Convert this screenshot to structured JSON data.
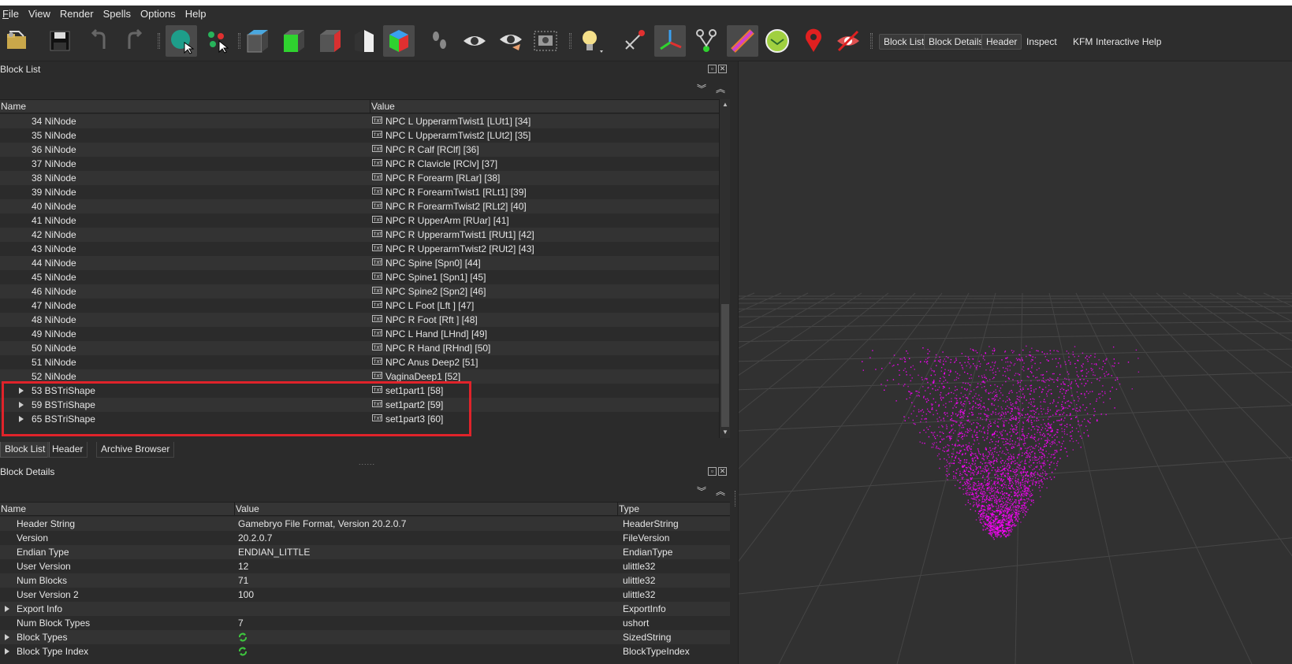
{
  "window": {
    "title_fragment": ""
  },
  "menubar": [
    {
      "label": "File",
      "mnemonic": "F",
      "rest": "ile"
    },
    {
      "label": "View"
    },
    {
      "label": "Render"
    },
    {
      "label": "Spells"
    },
    {
      "label": "Options"
    },
    {
      "label": "Help"
    }
  ],
  "toolbar": {
    "text_buttons": {
      "block_list": "Block List",
      "block_details": "Block Details",
      "header": "Header",
      "inspect": "Inspect",
      "kfm": "KFM",
      "interactive_help": "Interactive Help"
    }
  },
  "block_list": {
    "title": "Block List",
    "columns": {
      "name": "Name",
      "value": "Value"
    },
    "rows": [
      {
        "name": "34 NiNode",
        "value": "NPC L UpperarmTwist1 [LUt1] [34]"
      },
      {
        "name": "35 NiNode",
        "value": "NPC L UpperarmTwist2 [LUt2] [35]"
      },
      {
        "name": "36 NiNode",
        "value": "NPC R Calf [RClf] [36]"
      },
      {
        "name": "37 NiNode",
        "value": "NPC R Clavicle [RClv] [37]"
      },
      {
        "name": "38 NiNode",
        "value": "NPC R Forearm [RLar] [38]"
      },
      {
        "name": "39 NiNode",
        "value": "NPC R ForearmTwist1 [RLt1] [39]"
      },
      {
        "name": "40 NiNode",
        "value": "NPC R ForearmTwist2 [RLt2] [40]"
      },
      {
        "name": "41 NiNode",
        "value": "NPC R UpperArm [RUar] [41]"
      },
      {
        "name": "42 NiNode",
        "value": "NPC R UpperarmTwist1 [RUt1] [42]"
      },
      {
        "name": "43 NiNode",
        "value": "NPC R UpperarmTwist2 [RUt2] [43]"
      },
      {
        "name": "44 NiNode",
        "value": "NPC Spine [Spn0] [44]"
      },
      {
        "name": "45 NiNode",
        "value": "NPC Spine1 [Spn1] [45]"
      },
      {
        "name": "46 NiNode",
        "value": "NPC Spine2 [Spn2] [46]"
      },
      {
        "name": "47 NiNode",
        "value": "NPC L Foot [Lft ] [47]"
      },
      {
        "name": "48 NiNode",
        "value": "NPC R Foot [Rft ] [48]"
      },
      {
        "name": "49 NiNode",
        "value": "NPC L Hand [LHnd] [49]"
      },
      {
        "name": "50 NiNode",
        "value": "NPC R Hand [RHnd] [50]"
      },
      {
        "name": "51 NiNode",
        "value": "NPC Anus Deep2 [51]"
      },
      {
        "name": "52 NiNode",
        "value": "VaginaDeep1 [52]"
      },
      {
        "name": "53 BSTriShape",
        "value": "set1part1 [58]",
        "expandable": true
      },
      {
        "name": "59 BSTriShape",
        "value": "set1part2 [59]",
        "expandable": true
      },
      {
        "name": "65 BSTriShape",
        "value": "set1part3 [60]",
        "expandable": true
      }
    ]
  },
  "tabs": [
    {
      "label": "Block List",
      "active": true
    },
    {
      "label": "Header"
    },
    {
      "label": "Archive Browser"
    }
  ],
  "block_details": {
    "title": "Block Details",
    "columns": {
      "name": "Name",
      "value": "Value",
      "type": "Type"
    },
    "rows": [
      {
        "name": "Header String",
        "value": "Gamebryo File Format, Version 20.2.0.7",
        "type": "HeaderString"
      },
      {
        "name": "Version",
        "value": "20.2.0.7",
        "type": "FileVersion"
      },
      {
        "name": "Endian Type",
        "value": "ENDIAN_LITTLE",
        "type": "EndianType"
      },
      {
        "name": "User Version",
        "value": "12",
        "type": "ulittle32"
      },
      {
        "name": "Num Blocks",
        "value": "71",
        "type": "ulittle32"
      },
      {
        "name": "User Version 2",
        "value": "100",
        "type": "ulittle32"
      },
      {
        "name": "Export Info",
        "value": "",
        "type": "ExportInfo",
        "expandable": true
      },
      {
        "name": "Num Block Types",
        "value": "7",
        "type": "ushort"
      },
      {
        "name": "Block Types",
        "value": "",
        "type": "SizedString",
        "expandable": true,
        "icon": "refresh-icon"
      },
      {
        "name": "Block Type Index",
        "value": "",
        "type": "BlockTypeIndex",
        "expandable": true,
        "icon": "refresh-icon"
      }
    ]
  },
  "colors": {
    "accent_highlight": "#e0232a",
    "point_cloud": "#ff00ff",
    "background": "#2b2b2b"
  }
}
